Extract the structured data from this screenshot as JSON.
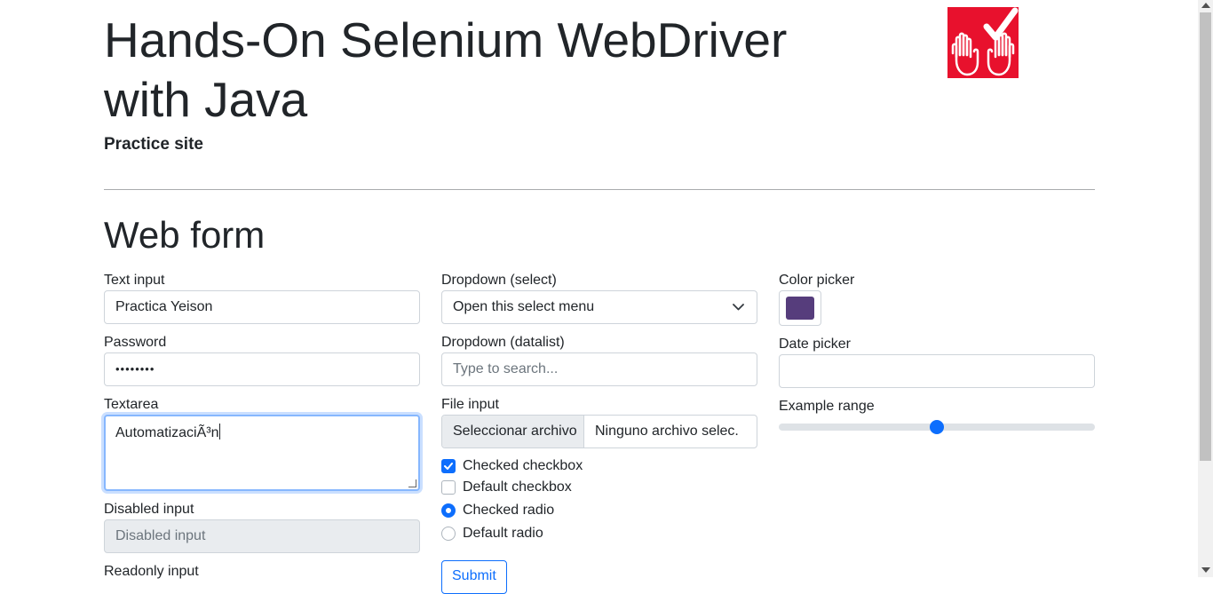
{
  "header": {
    "title": "Hands-On Selenium WebDriver with Java",
    "subtitle": "Practice site"
  },
  "logo": {
    "icon": "hands-check-logo",
    "color": "#e8112d"
  },
  "form": {
    "heading": "Web form",
    "text_input": {
      "label": "Text input",
      "value": "Practica Yeison"
    },
    "password": {
      "label": "Password",
      "value": "••••••••"
    },
    "textarea": {
      "label": "Textarea",
      "value": "AutomatizaciÃ³n"
    },
    "disabled_input": {
      "label": "Disabled input",
      "placeholder": "Disabled input"
    },
    "readonly_input": {
      "label": "Readonly input"
    },
    "dropdown_select": {
      "label": "Dropdown (select)",
      "selected": "Open this select menu"
    },
    "dropdown_datalist": {
      "label": "Dropdown (datalist)",
      "placeholder": "Type to search..."
    },
    "file_input": {
      "label": "File input",
      "button": "Seleccionar archivo",
      "status": "Ninguno archivo selec."
    },
    "checkboxes": [
      {
        "label": "Checked checkbox",
        "checked": true
      },
      {
        "label": "Default checkbox",
        "checked": false
      }
    ],
    "radios": [
      {
        "label": "Checked radio",
        "checked": true
      },
      {
        "label": "Default radio",
        "checked": false
      }
    ],
    "submit_label": "Submit",
    "color_picker": {
      "label": "Color picker",
      "value": "#563d7c"
    },
    "date_picker": {
      "label": "Date picker",
      "value": ""
    },
    "range": {
      "label": "Example range",
      "value": 50,
      "min": 0,
      "max": 100
    }
  },
  "colors": {
    "accent": "#0d6efd",
    "border": "#ced4da",
    "disabled_bg": "#e9ecef"
  }
}
